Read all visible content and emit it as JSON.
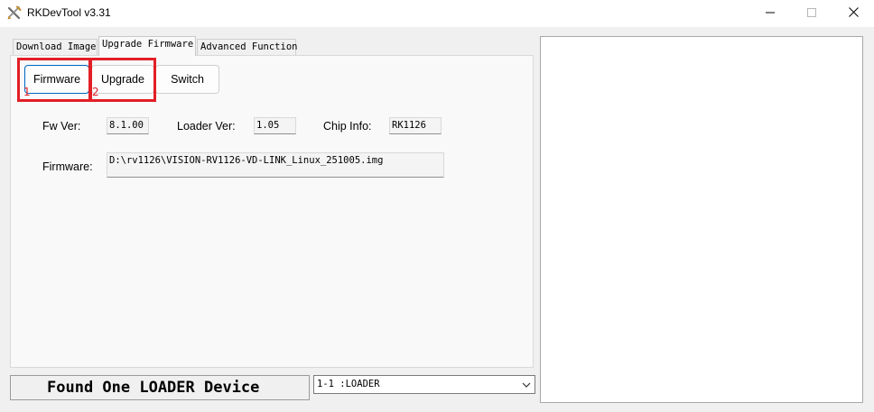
{
  "window": {
    "title": "RKDevTool v3.31",
    "controls": [
      "minimize",
      "maximize",
      "close"
    ]
  },
  "tabs": [
    {
      "label": "Download Image",
      "active": false
    },
    {
      "label": "Upgrade Firmware",
      "active": true
    },
    {
      "label": "Advanced Function",
      "active": false
    }
  ],
  "buttons": {
    "firmware": "Firmware",
    "upgrade": "Upgrade",
    "switch": "Switch"
  },
  "annotations": {
    "marker1": "1",
    "marker2": "2",
    "color": "#e21e26"
  },
  "info": {
    "fw_ver_label": "Fw Ver:",
    "fw_ver_value": "8.1.00",
    "loader_ver_label": "Loader Ver:",
    "loader_ver_value": "1.05",
    "chip_info_label": "Chip Info:",
    "chip_info_value": "RK1126",
    "firmware_label": "Firmware:",
    "firmware_path": "D:\\rv1126\\VISION-RV1126-VD-LINK_Linux_251005.img"
  },
  "status": {
    "message": "Found One LOADER Device"
  },
  "device_select": {
    "selected": "1-1 :LOADER"
  },
  "icons": [
    "app-logo-icon",
    "minimize-icon",
    "maximize-icon",
    "close-icon",
    "chevron-down-icon"
  ]
}
